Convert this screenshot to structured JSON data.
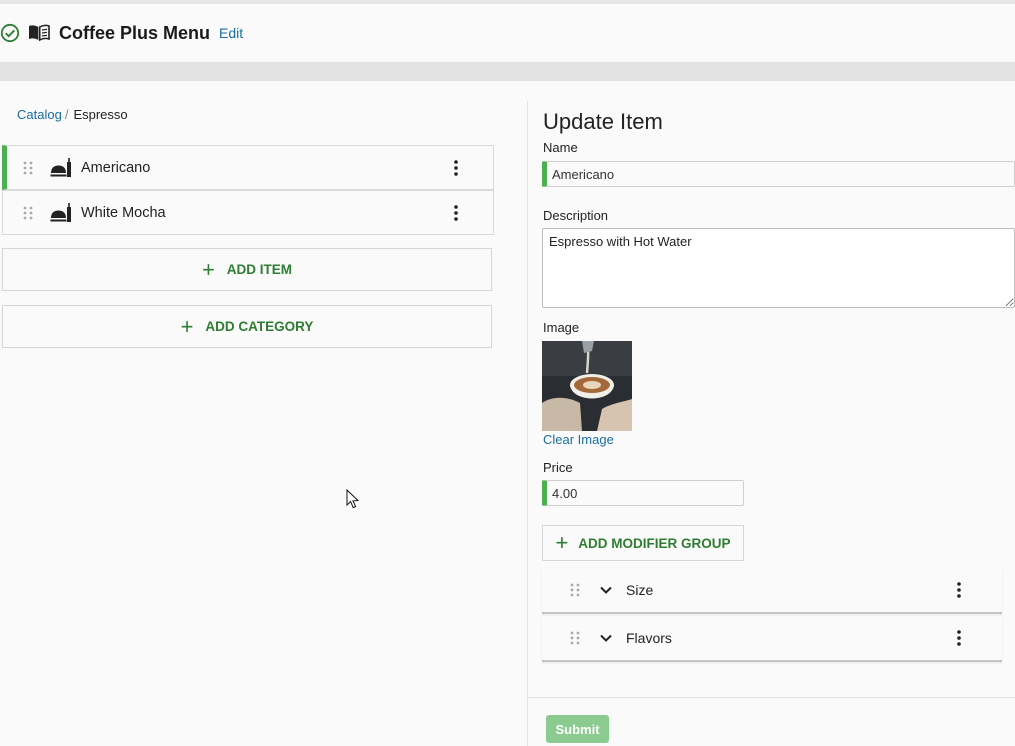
{
  "header": {
    "title": "Coffee Plus Menu",
    "edit_label": "Edit",
    "status_icon": "check-circle-icon",
    "menu_icon": "book-icon"
  },
  "breadcrumb": {
    "root": "Catalog",
    "separator": "/",
    "current": "Espresso"
  },
  "items": [
    {
      "label": "Americano",
      "active": true
    },
    {
      "label": "White Mocha",
      "active": false
    }
  ],
  "actions": {
    "add_item": "ADD ITEM",
    "add_category": "ADD CATEGORY"
  },
  "form": {
    "title": "Update Item",
    "name_label": "Name",
    "name_value": "Americano",
    "description_label": "Description",
    "description_value": "Espresso with Hot Water",
    "image_label": "Image",
    "clear_image": "Clear Image",
    "price_label": "Price",
    "price_value": "4.00",
    "add_modifier_group": "ADD MODIFIER GROUP",
    "modifier_groups": [
      {
        "label": "Size"
      },
      {
        "label": "Flavors"
      }
    ],
    "submit": "Submit"
  },
  "colors": {
    "accent_green": "#4caf50",
    "action_green": "#2e7d32",
    "link_blue": "#1a6ea0",
    "submit_disabled": "#81c784"
  }
}
